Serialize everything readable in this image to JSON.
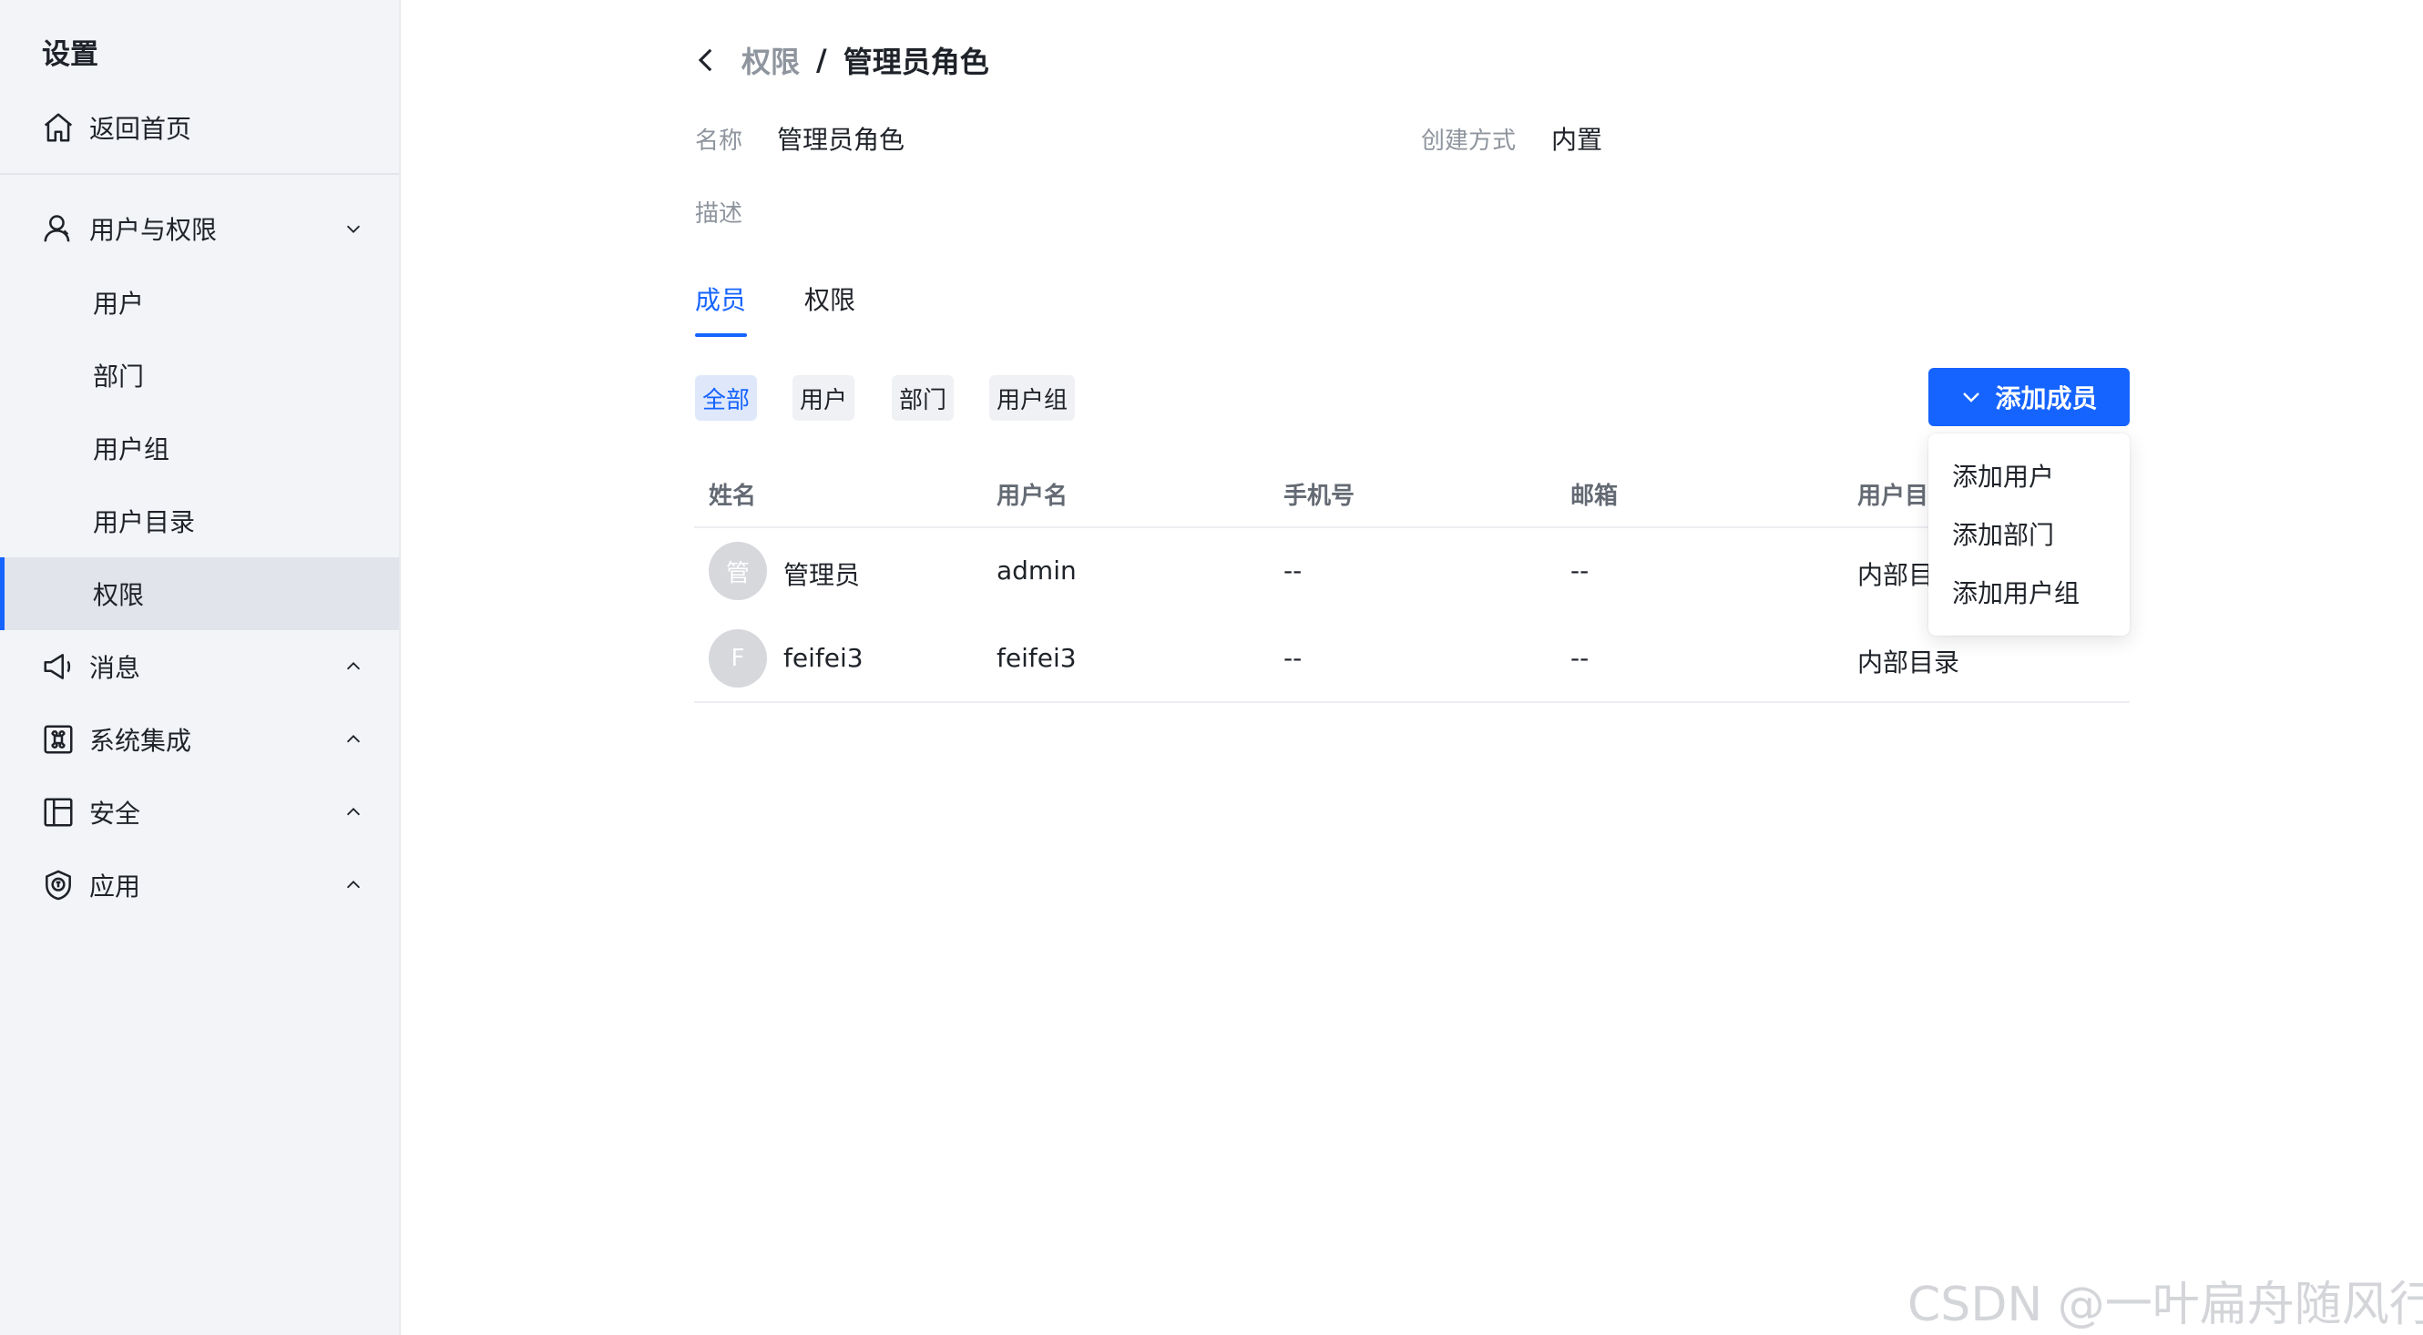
{
  "sidebar": {
    "title": "设置",
    "home": "返回首页",
    "groups": [
      {
        "label": "用户与权限",
        "icon": "user-icon",
        "expanded": true,
        "items": [
          "用户",
          "部门",
          "用户组",
          "用户目录",
          "权限"
        ],
        "active_item": "权限"
      },
      {
        "label": "消息",
        "icon": "megaphone-icon",
        "expanded": false
      },
      {
        "label": "系统集成",
        "icon": "command-icon",
        "expanded": false
      },
      {
        "label": "安全",
        "icon": "layout-icon",
        "expanded": false
      },
      {
        "label": "应用",
        "icon": "shield-cert-icon",
        "expanded": false
      }
    ]
  },
  "breadcrumb": {
    "parent": "权限",
    "separator": "/",
    "current": "管理员角色"
  },
  "details": {
    "name_label": "名称",
    "name_value": "管理员角色",
    "method_label": "创建方式",
    "method_value": "内置",
    "desc_label": "描述"
  },
  "tabs": [
    {
      "label": "成员",
      "active": true
    },
    {
      "label": "权限",
      "active": false
    }
  ],
  "filters": [
    {
      "label": "全部",
      "active": true
    },
    {
      "label": "用户",
      "active": false
    },
    {
      "label": "部门",
      "active": false
    },
    {
      "label": "用户组",
      "active": false
    }
  ],
  "add_button": "添加成员",
  "dropdown_items": [
    "添加用户",
    "添加部门",
    "添加用户组"
  ],
  "table": {
    "columns": [
      "姓名",
      "用户名",
      "手机号",
      "邮箱",
      "用户目"
    ],
    "rows": [
      {
        "avatar": "管",
        "name": "管理员",
        "username": "admin",
        "phone": "--",
        "email": "--",
        "directory": "内部目"
      },
      {
        "avatar": "F",
        "name": "feifei3",
        "username": "feifei3",
        "phone": "--",
        "email": "--",
        "directory": "内部目录"
      }
    ]
  },
  "watermark": "CSDN @一叶扁舟随风行",
  "colors": {
    "accent": "#1664ff",
    "sidebar_bg": "#f2f4f8",
    "muted_text": "#8f959e"
  }
}
